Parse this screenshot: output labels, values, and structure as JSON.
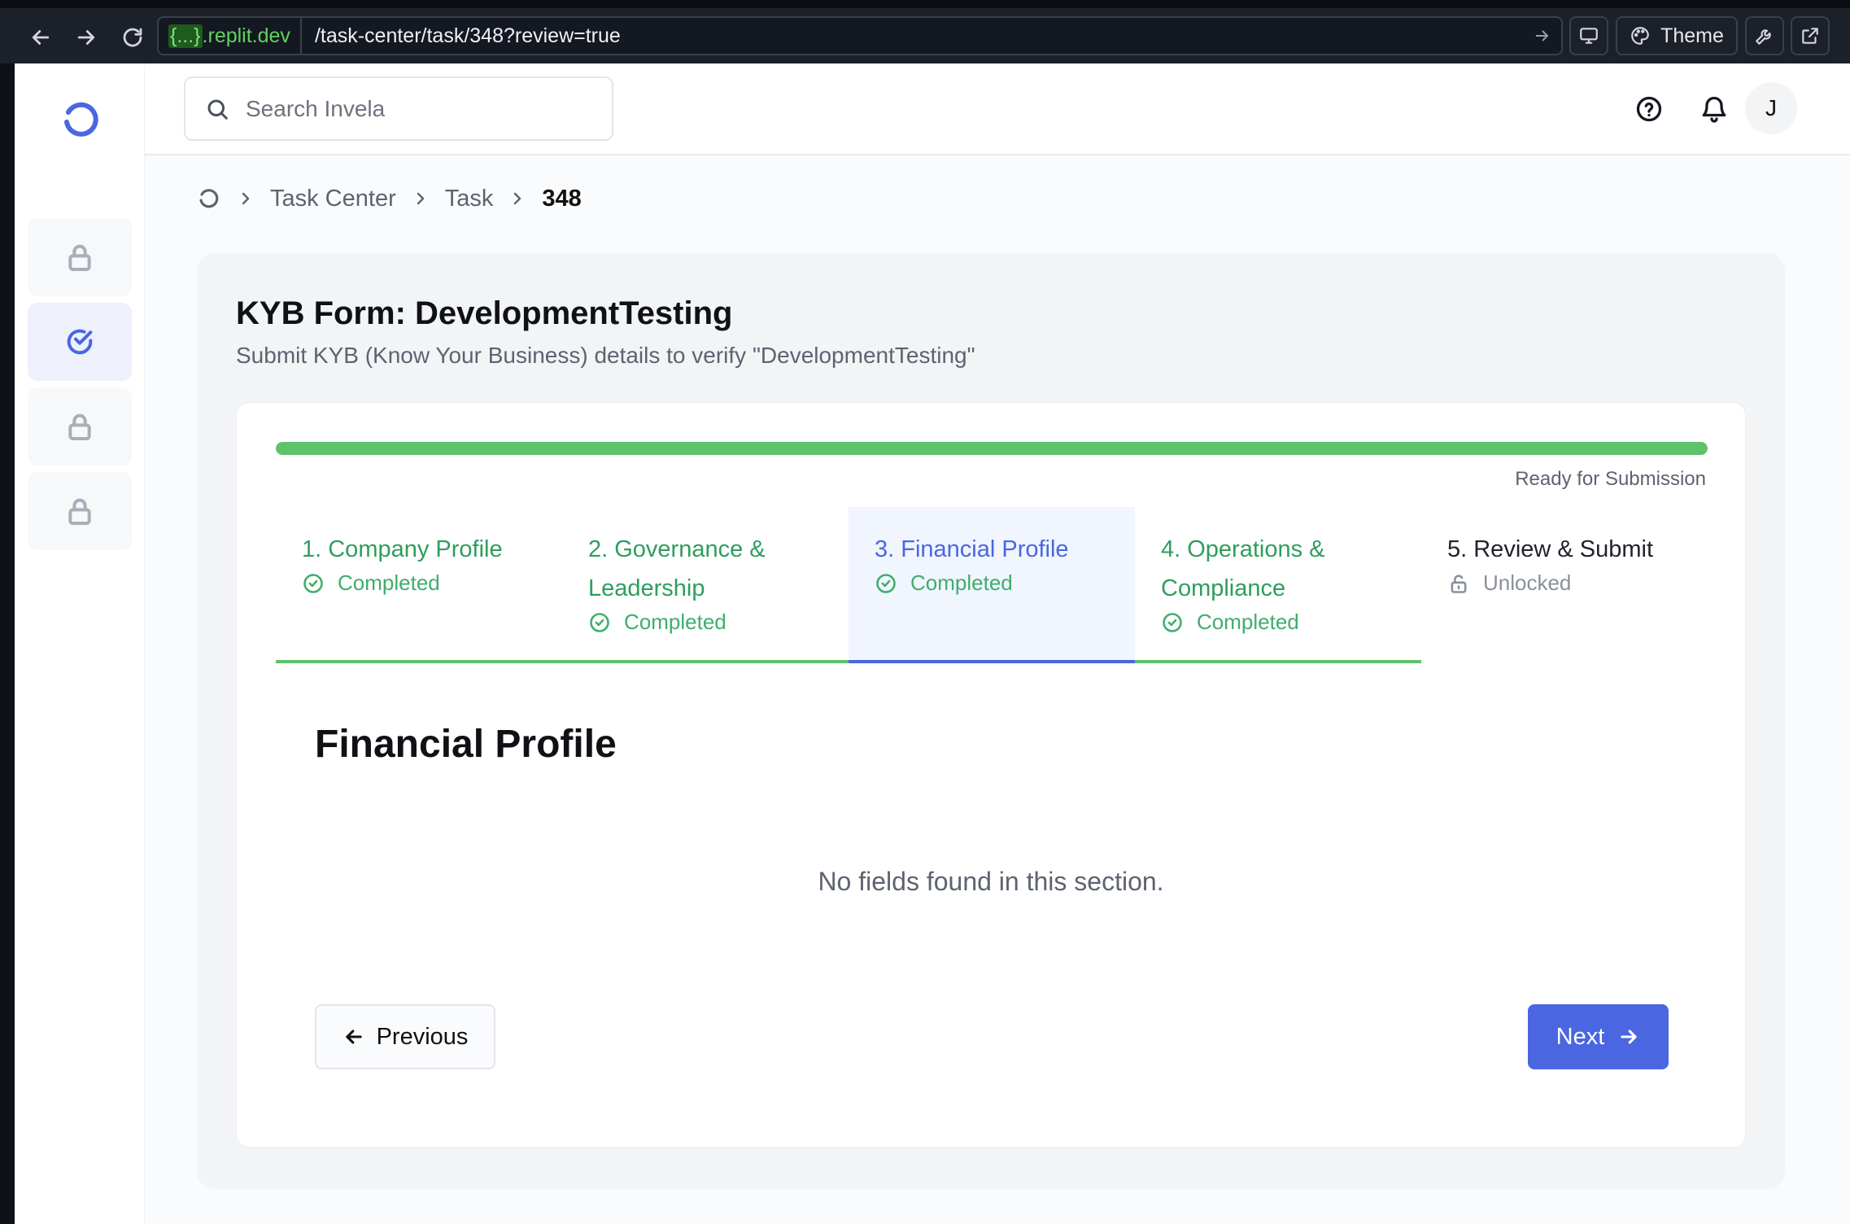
{
  "browser": {
    "url_domain_highlight": "{...}",
    "url_domain_rest": ".replit.dev",
    "url_path": "/task-center/task/348?review=true",
    "theme_label": "Theme"
  },
  "topbar": {
    "search_placeholder": "Search Invela",
    "avatar_initial": "J"
  },
  "breadcrumb": {
    "items": [
      "Task Center",
      "Task"
    ],
    "current": "348"
  },
  "form": {
    "title": "KYB Form: DevelopmentTesting",
    "subtitle": "Submit KYB (Know Your Business) details to verify \"DevelopmentTesting\"",
    "progress_percent": 100,
    "progress_status": "Ready for Submission",
    "steps": [
      {
        "title": "1. Company Profile",
        "status": "Completed",
        "state": "done"
      },
      {
        "title": "2. Governance & Leadership",
        "status": "Completed",
        "state": "done"
      },
      {
        "title": "3. Financial Profile",
        "status": "Completed",
        "state": "active"
      },
      {
        "title": "4. Operations & Compliance",
        "status": "Completed",
        "state": "done"
      },
      {
        "title": "5. Review & Submit",
        "status": "Unlocked",
        "state": "locked"
      }
    ],
    "section_title": "Financial Profile",
    "empty_message": "No fields found in this section.",
    "prev_label": "Previous",
    "next_label": "Next"
  },
  "colors": {
    "accent": "#4a66e0",
    "success": "#5ec26a",
    "sidebar_lock": "#a9aeb8"
  },
  "icons": {
    "sidebar": [
      "lock-icon",
      "check-circle-icon",
      "lock-icon",
      "lock-icon"
    ],
    "topbar": [
      "search-icon",
      "help-icon",
      "bell-icon"
    ]
  }
}
